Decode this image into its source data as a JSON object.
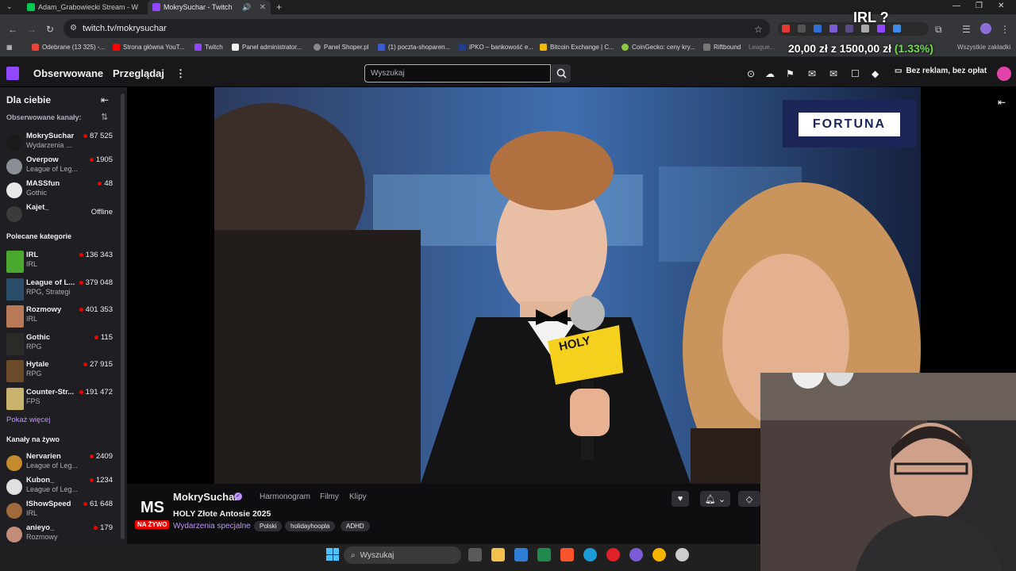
{
  "browser": {
    "tabs": [
      {
        "title": "Adam_Grabowiecki Stream - W",
        "active": false
      },
      {
        "title": "MokrySuchar - Twitch",
        "active": true
      }
    ],
    "url": "twitch.tv/mokrysuchar",
    "bookmarks": [
      "Odebrane (13 325) -...",
      "Strona główna YouT...",
      "Twitch",
      "Panel administrator...",
      "Panel Shoper.pl",
      "(1) poczta-shoparen...",
      "iPKO – bankowość e...",
      "Bitcoin Exchange | C...",
      "CoinGecko: ceny kry...",
      "Riftbound",
      "League...",
      "Wszystkie zakładki"
    ]
  },
  "overlay": {
    "irl": "IRL ?",
    "goal_current": "20,00 zł",
    "goal_sep": "z",
    "goal_target": "1500,00 zł",
    "goal_pct": "(1.33%)"
  },
  "twitch": {
    "nav": {
      "followed": "Obserwowane",
      "browse": "Przeglądaj",
      "search_placeholder": "Wyszukaj",
      "noads": "Bez reklam, bez opłat"
    },
    "sidebar": {
      "title": "Dla ciebie",
      "followed_header": "Obserwowane kanały:",
      "followed": [
        {
          "name": "MokrySuchar",
          "sub": "Wydarzenia ...",
          "viewers": "87 525",
          "live": true,
          "color": "#1a1a1a"
        },
        {
          "name": "Overpow",
          "sub": "League of Leg...",
          "viewers": "1905",
          "live": true,
          "color": "#8a8f96"
        },
        {
          "name": "MASSfun",
          "sub": "Gothic",
          "viewers": "48",
          "live": true,
          "color": "#e8e8e8"
        },
        {
          "name": "Kajet_",
          "sub": "",
          "viewers": "Offline",
          "live": false,
          "color": "#3b3b3b"
        }
      ],
      "categories_header": "Polecane kategorie",
      "categories": [
        {
          "name": "IRL",
          "sub": "IRL",
          "viewers": "136 343",
          "color": "#4aa82e"
        },
        {
          "name": "League of L...",
          "sub": "RPG, Strategi",
          "viewers": "379 048",
          "color": "#2a4e6a"
        },
        {
          "name": "Rozmowy",
          "sub": "IRL",
          "viewers": "401 353",
          "color": "#b87a56"
        },
        {
          "name": "Gothic",
          "sub": "RPG",
          "viewers": "115",
          "color": "#2a2a28"
        },
        {
          "name": "Hytale",
          "sub": "RPG",
          "viewers": "27 915",
          "color": "#6b4a2a"
        },
        {
          "name": "Counter-Str...",
          "sub": "FPS",
          "viewers": "191 472",
          "color": "#c9b26b"
        }
      ],
      "show_more": "Pokaż więcej",
      "live_header": "Kanały na żywo",
      "live": [
        {
          "name": "Nervarien",
          "sub": "League of Leg...",
          "viewers": "2409",
          "color": "#c48a2e"
        },
        {
          "name": "Kubon_",
          "sub": "League of Leg...",
          "viewers": "1234",
          "color": "#e0e0e0"
        },
        {
          "name": "IShowSpeed",
          "sub": "IRL",
          "viewers": "61 648",
          "color": "#a06a3c"
        },
        {
          "name": "anieyo_",
          "sub": "Rozmowy",
          "viewers": "179",
          "color": "#c48c7a"
        }
      ]
    },
    "stream": {
      "logo": "MS",
      "live_badge": "NA ŻYWO",
      "channel": "MokrySuchar",
      "tabs": [
        "Harmonogram",
        "Filmy",
        "Klipy"
      ],
      "title": "HOLY Złote Antosie 2025",
      "category": "Wydarzenia specjalne",
      "tags": [
        "Polski",
        "holidayhoopla",
        "ADHD"
      ],
      "sponsor": "FORTUNA",
      "mic_brand": "HOLY"
    }
  },
  "taskbar": {
    "search": "Wyszukaj"
  }
}
